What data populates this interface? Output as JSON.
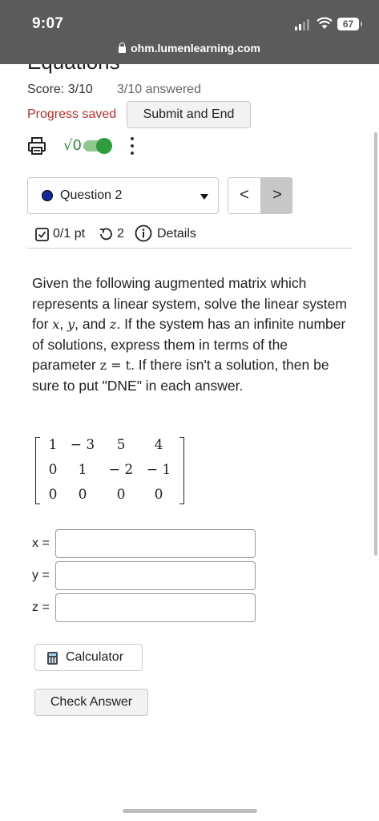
{
  "status_bar": {
    "time": "9:07",
    "battery": "67"
  },
  "browser": {
    "url": "ohm.lumenlearning.com"
  },
  "page": {
    "title_clipped": "Equations",
    "score": "Score: 3/10",
    "answered": "3/10 answered",
    "progress": "Progress saved",
    "submit_label": "Submit and End",
    "sqrt_symbol": "√0"
  },
  "question_nav": {
    "selected": "Question 2",
    "prev": "<",
    "next": ">"
  },
  "details": {
    "points": "0/1 pt",
    "attempts": "2",
    "details_label": "Details"
  },
  "question": {
    "p1": "Given the following augmented matrix which represents a linear system, solve the linear system for ",
    "var_x": "x",
    "sep1": ", ",
    "var_y": "y",
    "sep2": ", and ",
    "var_z": "z",
    "p2": ". If the system has an infinite number of solutions, express them in terms of the parameter ",
    "param_eq": "z = t",
    "p3": ". If there isn't a solution, then be sure to put \"DNE\" in each answer."
  },
  "matrix": {
    "rows": [
      [
        "1",
        "− 3",
        "5",
        "4"
      ],
      [
        "0",
        "1",
        "− 2",
        "− 1"
      ],
      [
        "0",
        "0",
        "0",
        "0"
      ]
    ]
  },
  "answers": {
    "x_label": "x =",
    "y_label": "y =",
    "z_label": "z =",
    "x_value": "",
    "y_value": "",
    "z_value": ""
  },
  "buttons": {
    "calculator": "Calculator",
    "check": "Check Answer"
  }
}
